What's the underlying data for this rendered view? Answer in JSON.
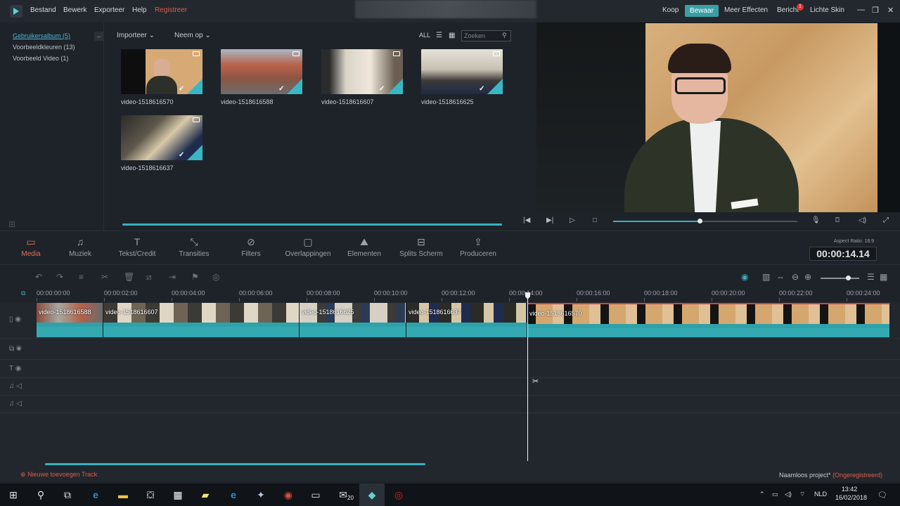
{
  "menu": {
    "items": [
      "Bestand",
      "Bewerk",
      "Exporteer",
      "Help"
    ],
    "register": "Registreer"
  },
  "topbar": {
    "koop": "Koop",
    "bewaar": "Bewaar",
    "meer_effecten": "Meer Effecten",
    "bericht": "Bericht",
    "bericht_count": "1",
    "skin": "Lichte Skin"
  },
  "library": {
    "sidebar": [
      "Gebruikersalbum (5)",
      "Voorbeeldkleuren (13)",
      "Voorbeeld Video (1)"
    ],
    "importeer": "Importeer",
    "neem_op": "Neem op",
    "all": "ALL",
    "search_placeholder": "Zoeken",
    "media": [
      "video-1518616570",
      "video-1518616588",
      "video-1518616607",
      "video-1518616625",
      "video-1518616637"
    ]
  },
  "modules": [
    "Media",
    "Muziek",
    "Tekst/Credit",
    "Transities",
    "Filters",
    "Overlappingen",
    "Elementen",
    "Splits Scherm",
    "Produceren"
  ],
  "preview": {
    "aspect_ratio": "Aspect Ratio: 16:9",
    "timecode": "00:00:14.14",
    "progress": 0.47
  },
  "timeline": {
    "ruler": [
      "00:00:00:00",
      "00:00:02:00",
      "00:00:04:00",
      "00:00:06:00",
      "00:00:08:00",
      "00:00:10:00",
      "00:00:12:00",
      "00:00:14:00",
      "00:00:16:00",
      "00:00:18:00",
      "00:00:20:00",
      "00:00:22:00",
      "00:00:24:00"
    ],
    "clips": [
      "video-1518616588",
      "video-1518616607",
      "video-1518616625",
      "video-1518616637",
      "video-1518616570"
    ],
    "add_track": "Nieuwe toevoegen Track",
    "project_name": "Naamloos project*",
    "project_status": "(Ongeregistreerd)"
  },
  "taskbar": {
    "mail_badge": "20",
    "lang": "NLD",
    "time": "13:42",
    "date": "16/02/2018"
  },
  "colors": {
    "accent": "#3bb0bd",
    "active_module": "#e56f53",
    "register": "#e05a4e"
  }
}
